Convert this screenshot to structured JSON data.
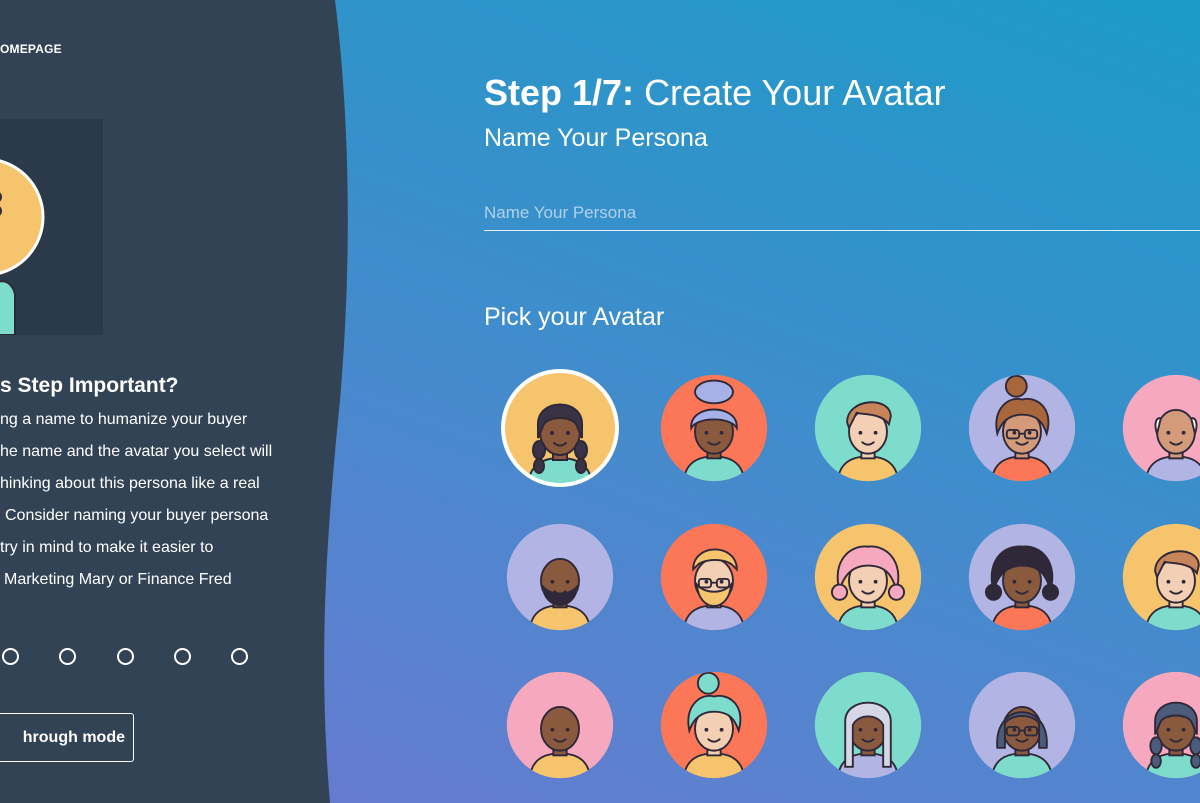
{
  "sidebar": {
    "home_link": "OMEPAGE",
    "why_title": "s Step Important?",
    "why_lines": [
      "ng a name to humanize your buyer",
      "he name and the avatar you select will",
      "hinking about this persona like a real",
      "Consider naming your buyer persona",
      "try in mind to make it easier to",
      "Marketing Mary or Finance Fred"
    ],
    "walkthrough_label": "hrough mode",
    "progress_dots": 5
  },
  "main": {
    "step_label": "Step 1/7:",
    "step_title": "Create Your Avatar",
    "subtitle": "Name Your Persona",
    "name_placeholder": "Name Your Persona",
    "name_value": "",
    "pick_title": "Pick your Avatar"
  },
  "colors": {
    "sidebar_bg": "#324355",
    "accent_white": "#ffffff",
    "yellow": "#f6c46c",
    "orange": "#fb7757",
    "teal": "#7edccd",
    "lavender": "#b2b4e3",
    "pink": "#f6a9be",
    "skin_dark": "#8a5a3f",
    "skin_light": "#f3cfb3",
    "skin_tan": "#d39b7a"
  },
  "avatars": [
    {
      "id": "a1",
      "bg": "yellow",
      "skin": "skin_dark",
      "hair": "#3a3245",
      "shirt": "teal",
      "style": "braids",
      "selected": true
    },
    {
      "id": "a2",
      "bg": "orange",
      "skin": "skin_dark",
      "hair": "#a8b0e8",
      "shirt": "teal",
      "style": "bun"
    },
    {
      "id": "a3",
      "bg": "teal",
      "skin": "skin_light",
      "hair": "#c9855a",
      "shirt": "yellow",
      "style": "short"
    },
    {
      "id": "a4",
      "bg": "lavender",
      "skin": "skin_tan",
      "hair": "#a8663c",
      "shirt": "orange",
      "style": "curly-bun",
      "glasses": true
    },
    {
      "id": "a5",
      "bg": "pink",
      "skin": "skin_tan",
      "hair": "#f3f3f3",
      "shirt": "lavender",
      "style": "bald-sides"
    },
    {
      "id": "a6",
      "bg": "lavender",
      "skin": "skin_dark",
      "hair": "#2e2838",
      "shirt": "yellow",
      "style": "beard"
    },
    {
      "id": "a7",
      "bg": "orange",
      "skin": "skin_light",
      "hair": "#f6c46c",
      "shirt": "lavender",
      "style": "short-beard",
      "glasses": true
    },
    {
      "id": "a8",
      "bg": "yellow",
      "skin": "skin_light",
      "hair": "#f6a9be",
      "shirt": "teal",
      "style": "curly"
    },
    {
      "id": "a9",
      "bg": "lavender",
      "skin": "skin_dark",
      "hair": "#2e2838",
      "shirt": "orange",
      "style": "curly"
    },
    {
      "id": "a10",
      "bg": "yellow",
      "skin": "skin_light",
      "hair": "#c9855a",
      "shirt": "teal",
      "style": "short"
    },
    {
      "id": "a11",
      "bg": "pink",
      "skin": "skin_dark",
      "hair": "#8a5a3f",
      "shirt": "yellow",
      "style": "bald"
    },
    {
      "id": "a12",
      "bg": "orange",
      "skin": "skin_light",
      "hair": "#7edccd",
      "shirt": "yellow",
      "style": "curly-bun"
    },
    {
      "id": "a13",
      "bg": "teal",
      "skin": "skin_dark",
      "hair": "#d6d7e6",
      "shirt": "lavender",
      "style": "long"
    },
    {
      "id": "a14",
      "bg": "lavender",
      "skin": "skin_dark",
      "hair": "#4b5b7a",
      "shirt": "teal",
      "style": "bob",
      "glasses": true
    },
    {
      "id": "a15",
      "bg": "pink",
      "skin": "skin_dark",
      "hair": "#4b5b7a",
      "shirt": "teal",
      "style": "braids"
    }
  ]
}
